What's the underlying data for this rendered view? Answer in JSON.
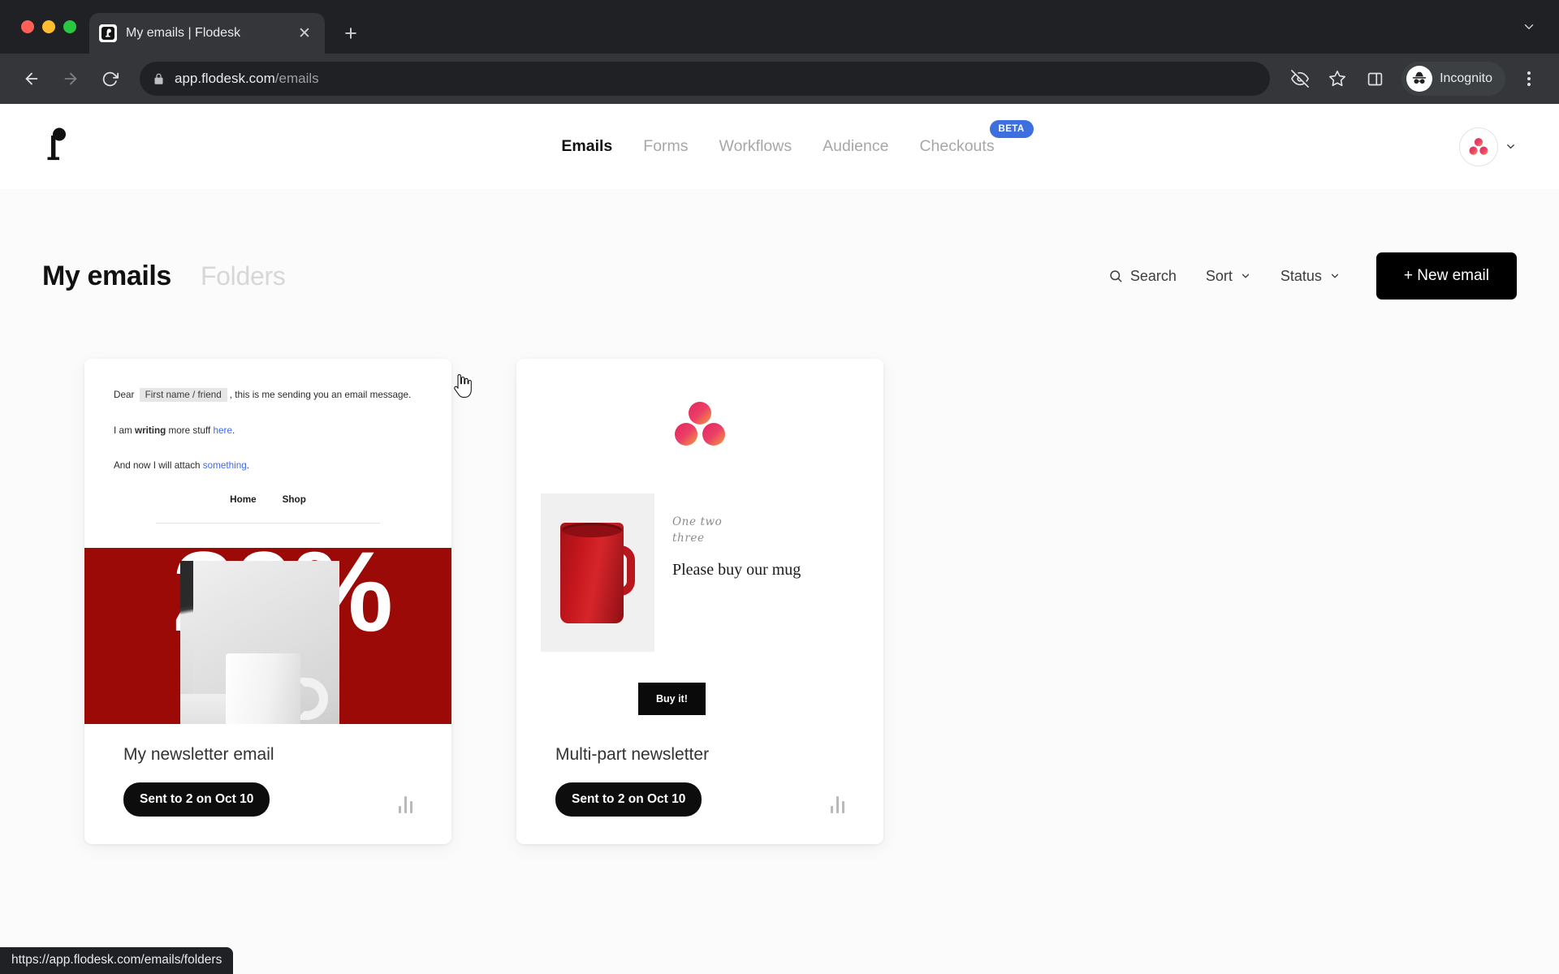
{
  "browser": {
    "tab": {
      "title": "My emails | Flodesk",
      "favicon_icon": "flodesk-f-favicon",
      "close_icon": "close-icon"
    },
    "new_tab_icon": "plus-icon",
    "tab_list_icon": "chevron-down-icon",
    "back_icon": "back-arrow-icon",
    "forward_icon": "forward-arrow-icon",
    "reload_icon": "reload-icon",
    "omnibox": {
      "lock_icon": "lock-icon",
      "url_domain": "app.flodesk.com",
      "url_path": "/emails"
    },
    "actions": {
      "tracking_protection_icon": "eye-slash-icon",
      "bookmark_icon": "star-icon",
      "side_panel_icon": "side-panel-icon"
    },
    "profile": {
      "label": "Incognito",
      "icon": "incognito-icon"
    },
    "menu_icon": "kebab-menu-icon"
  },
  "statusbar": {
    "url": "https://app.flodesk.com/emails/folders"
  },
  "appnav": {
    "logo_icon": "flodesk-logo",
    "items": [
      {
        "label": "Emails",
        "active": true
      },
      {
        "label": "Forms",
        "active": false
      },
      {
        "label": "Workflows",
        "active": false
      },
      {
        "label": "Audience",
        "active": false
      },
      {
        "label": "Checkouts",
        "active": false,
        "badge": "BETA"
      }
    ],
    "badge_color": "#3d6fdf",
    "avatar_icon": "flodesk-avatar-dots",
    "avatar_chevron_icon": "chevron-down-icon"
  },
  "page": {
    "title": "My emails",
    "folders_tab": "Folders",
    "tools": {
      "search": {
        "label": "Search",
        "icon": "search-icon"
      },
      "sort": {
        "label": "Sort",
        "icon": "chevron-down-icon"
      },
      "status": {
        "label": "Status",
        "icon": "chevron-down-icon"
      },
      "new_email": {
        "label": "+ New email"
      }
    }
  },
  "cards": [
    {
      "name": "My newsletter email",
      "status": "Sent to 2 on Oct 10",
      "stats_icon": "bar-chart-icon",
      "preview": {
        "type": "newsletter",
        "line1_pre": "Dear",
        "merge_tag": "First name / friend",
        "line1_post": ", this is me sending you an email message.",
        "line2_pre": "I am ",
        "line2_bold": "writing",
        "line2_mid": " more stuff ",
        "line2_link": "here",
        "line2_post": ".",
        "line3_pre": "And now I will attach ",
        "line3_link": "something",
        "line3_post": ".",
        "nav": [
          "Home",
          "Shop"
        ],
        "banner_text": "20%",
        "banner_color": "#9b0a06"
      }
    },
    {
      "name": "Multi-part newsletter",
      "status": "Sent to 2 on Oct 10",
      "stats_icon": "bar-chart-icon",
      "preview": {
        "type": "product",
        "logo_icon": "flodesk-three-dots-logo",
        "script_line1": "One  two",
        "script_line2": "three",
        "headline": "Please buy our mug",
        "button_label": "Buy it!",
        "product_image": "red-mug-photo"
      }
    }
  ],
  "cursor": {
    "icon": "pointing-hand-cursor"
  }
}
